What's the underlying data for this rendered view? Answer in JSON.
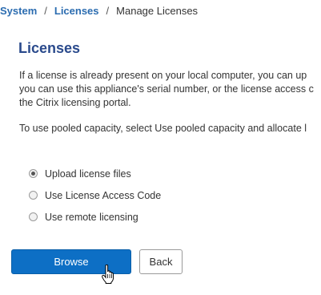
{
  "breadcrumb": {
    "items": [
      "System",
      "Licenses"
    ],
    "separator": "/",
    "current": "Manage Licenses"
  },
  "page": {
    "title": "Licenses",
    "description_lines": [
      "If a license is already present on your local computer, you can up",
      "you can use this appliance's serial number, or the license access c",
      "the Citrix licensing portal."
    ],
    "pooled_text": "To use pooled capacity, select Use pooled capacity and allocate l"
  },
  "options": [
    {
      "label": "Upload license files",
      "selected": true
    },
    {
      "label": "Use License Access Code",
      "selected": false
    },
    {
      "label": "Use remote licensing",
      "selected": false
    }
  ],
  "buttons": {
    "browse": "Browse",
    "back": "Back"
  },
  "cursor": "hand-pointer-icon",
  "colors": {
    "link": "#2b6cb0",
    "title": "#2a4a8c",
    "primary_button": "#0d6fc5"
  }
}
